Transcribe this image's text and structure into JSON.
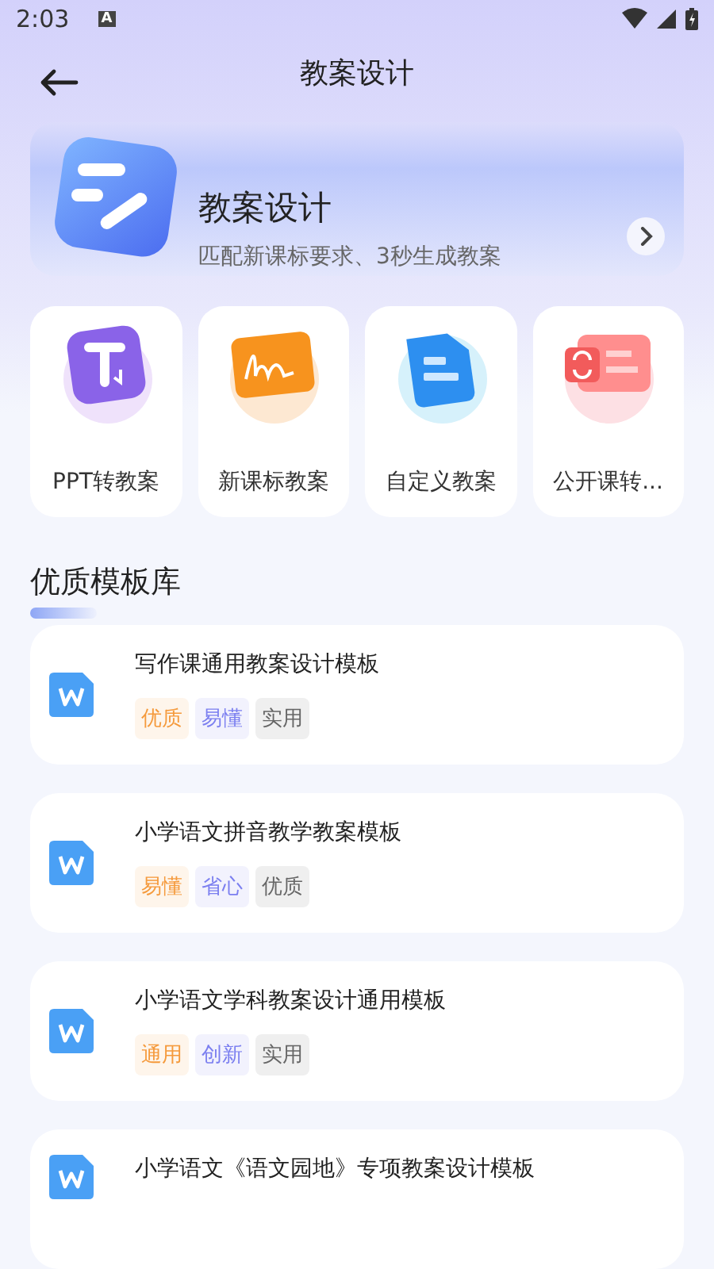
{
  "status_bar": {
    "time": "2:03",
    "badge": "A"
  },
  "header": {
    "title": "教案设计"
  },
  "banner": {
    "title": "教案设计",
    "subtitle": "匹配新课标要求、3秒生成教案"
  },
  "features": [
    {
      "kind": "ppt",
      "label": "PPT转教案"
    },
    {
      "kind": "standard",
      "label": "新课标教案"
    },
    {
      "kind": "custom",
      "label": "自定义教案"
    },
    {
      "kind": "open",
      "label": "公开课转..."
    }
  ],
  "section": {
    "title": "优质模板库"
  },
  "templates": [
    {
      "title": "写作课通用教案设计模板",
      "tags": [
        {
          "text": "优质",
          "color": "#f59a3c"
        },
        {
          "text": "易懂",
          "color": "#7b7ff0"
        },
        {
          "text": "实用",
          "color": "#666666"
        }
      ]
    },
    {
      "title": "小学语文拼音教学教案模板",
      "tags": [
        {
          "text": "易懂",
          "color": "#f59a3c"
        },
        {
          "text": "省心",
          "color": "#7b7ff0"
        },
        {
          "text": "优质",
          "color": "#666666"
        }
      ]
    },
    {
      "title": "小学语文学科教案设计通用模板",
      "tags": [
        {
          "text": "通用",
          "color": "#f59a3c"
        },
        {
          "text": "创新",
          "color": "#7b7ff0"
        },
        {
          "text": "实用",
          "color": "#666666"
        }
      ]
    },
    {
      "title": "小学语文《语文园地》专项教案设计模板"
    }
  ]
}
